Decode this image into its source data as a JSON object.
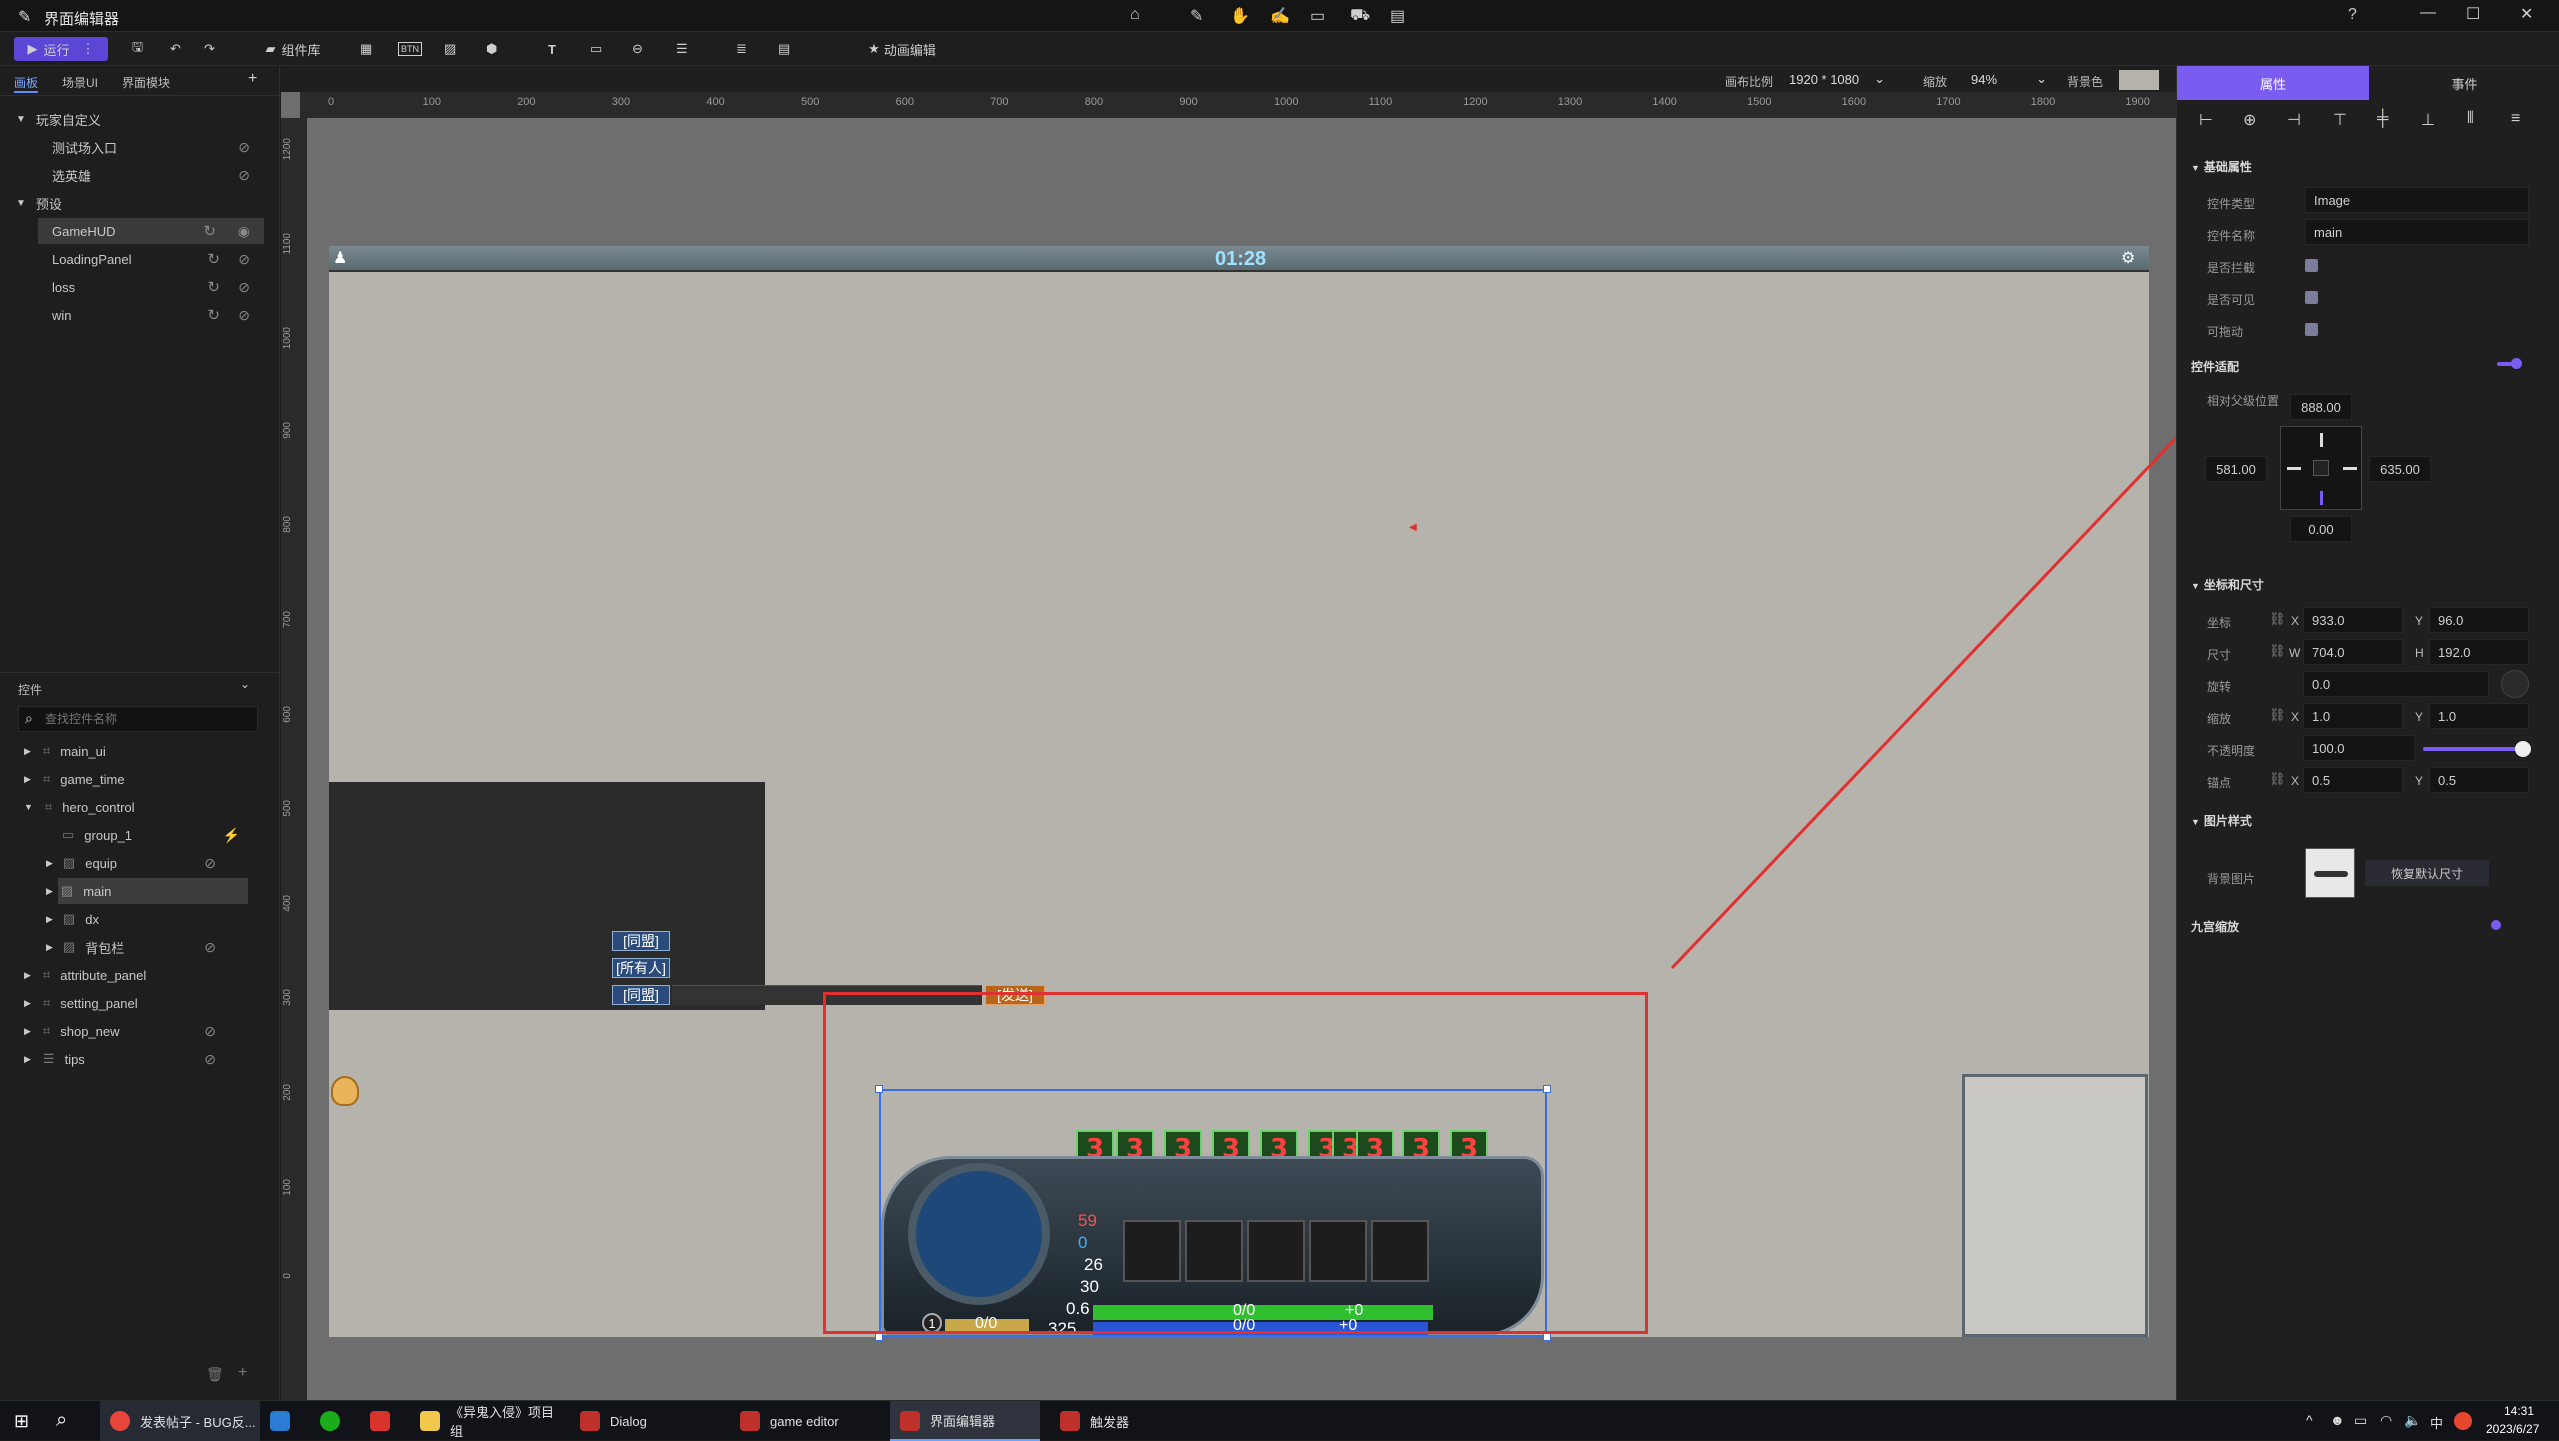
{
  "titlebar": {
    "title": "界面编辑器"
  },
  "toolbar": {
    "run_label": "运行",
    "component_lib": "组件库",
    "btn_badge": "BTN",
    "anim_editor": "动画编辑",
    "ratio_label": "画布比例",
    "ratio_value": "1920 * 1080",
    "zoom_label": "缩放",
    "zoom_value": "94%",
    "bg_label": "背景色"
  },
  "left": {
    "tabs": [
      "画板",
      "场景UI",
      "界面模块"
    ],
    "groups": [
      {
        "label": "玩家自定义",
        "items": [
          "测试场入口",
          "选英雄"
        ]
      },
      {
        "label": "预设",
        "items": [
          "GameHUD",
          "LoadingPanel",
          "loss",
          "win"
        ]
      }
    ],
    "controls_title": "控件",
    "search_placeholder": "查找控件名称",
    "tree": [
      "main_ui",
      "game_time",
      "hero_control",
      "group_1",
      "equip",
      "main",
      "dx",
      "背包栏",
      "attribute_panel",
      "setting_panel",
      "shop_new",
      "tips"
    ]
  },
  "ruler": {
    "top": [
      "0",
      "100",
      "200",
      "300",
      "400",
      "500",
      "600",
      "700",
      "800",
      "900",
      "1000",
      "1100",
      "1200",
      "1300",
      "1400",
      "1500",
      "1600",
      "1700",
      "1800",
      "1900"
    ],
    "left": [
      "1200",
      "1100",
      "1000",
      "900",
      "800",
      "700",
      "600",
      "500",
      "400",
      "300",
      "200",
      "100",
      "0"
    ]
  },
  "canvas": {
    "timer": "01:28",
    "chat_buttons": [
      "[同盟]",
      "[所有人]",
      "[同盟]"
    ],
    "send_button": "[发送]",
    "skill_digit": "3",
    "hud": {
      "stats": [
        "59",
        "0",
        "26",
        "30",
        "0.6",
        "325"
      ],
      "level": "1",
      "xp": "0/0",
      "hp": "0/0",
      "hp_regen": "+0",
      "mp": "0/0",
      "mp_regen": "+0"
    }
  },
  "right": {
    "tabs": [
      "属性",
      "事件"
    ],
    "basic_section": "基础属性",
    "type_label": "控件类型",
    "type_value": "Image",
    "name_label": "控件名称",
    "name_value": "main",
    "intercept_label": "是否拦截",
    "visible_label": "是否可见",
    "draggable_label": "可拖动",
    "adapt_label": "控件适配",
    "parent_pos_label": "相对父级位置",
    "anchor_top": "888.00",
    "anchor_left": "581.00",
    "anchor_right": "635.00",
    "anchor_bottom": "0.00",
    "coord_section": "坐标和尺寸",
    "pos_label": "坐标",
    "pos_x": "933.0",
    "pos_y": "96.0",
    "size_label": "尺寸",
    "size_w": "704.0",
    "size_h": "192.0",
    "rot_label": "旋转",
    "rot_value": "0.0",
    "scale_label": "缩放",
    "scale_x": "1.0",
    "scale_y": "1.0",
    "opacity_label": "不透明度",
    "opacity_value": "100.0",
    "pivot_label": "锚点",
    "pivot_x": "0.5",
    "pivot_y": "0.5",
    "x": "X",
    "y": "Y",
    "w": "W",
    "h": "H",
    "image_section": "图片样式",
    "bg_image_label": "背景图片",
    "restore_size": "恢复默认尺寸",
    "nine_slice_label": "九宫缩放"
  },
  "taskbar": {
    "apps": [
      "发表帖子 - BUG反...",
      "《异鬼入侵》项目组",
      "Dialog",
      "game editor",
      "界面编辑器",
      "触发器"
    ],
    "time": "14:31",
    "date": "2023/6/27",
    "ime": "中"
  },
  "colors": {
    "accent": "#7b5cf0",
    "selection_red": "#e03030",
    "hp_green": "#2fbf2f",
    "mp_blue": "#2a56d6"
  }
}
